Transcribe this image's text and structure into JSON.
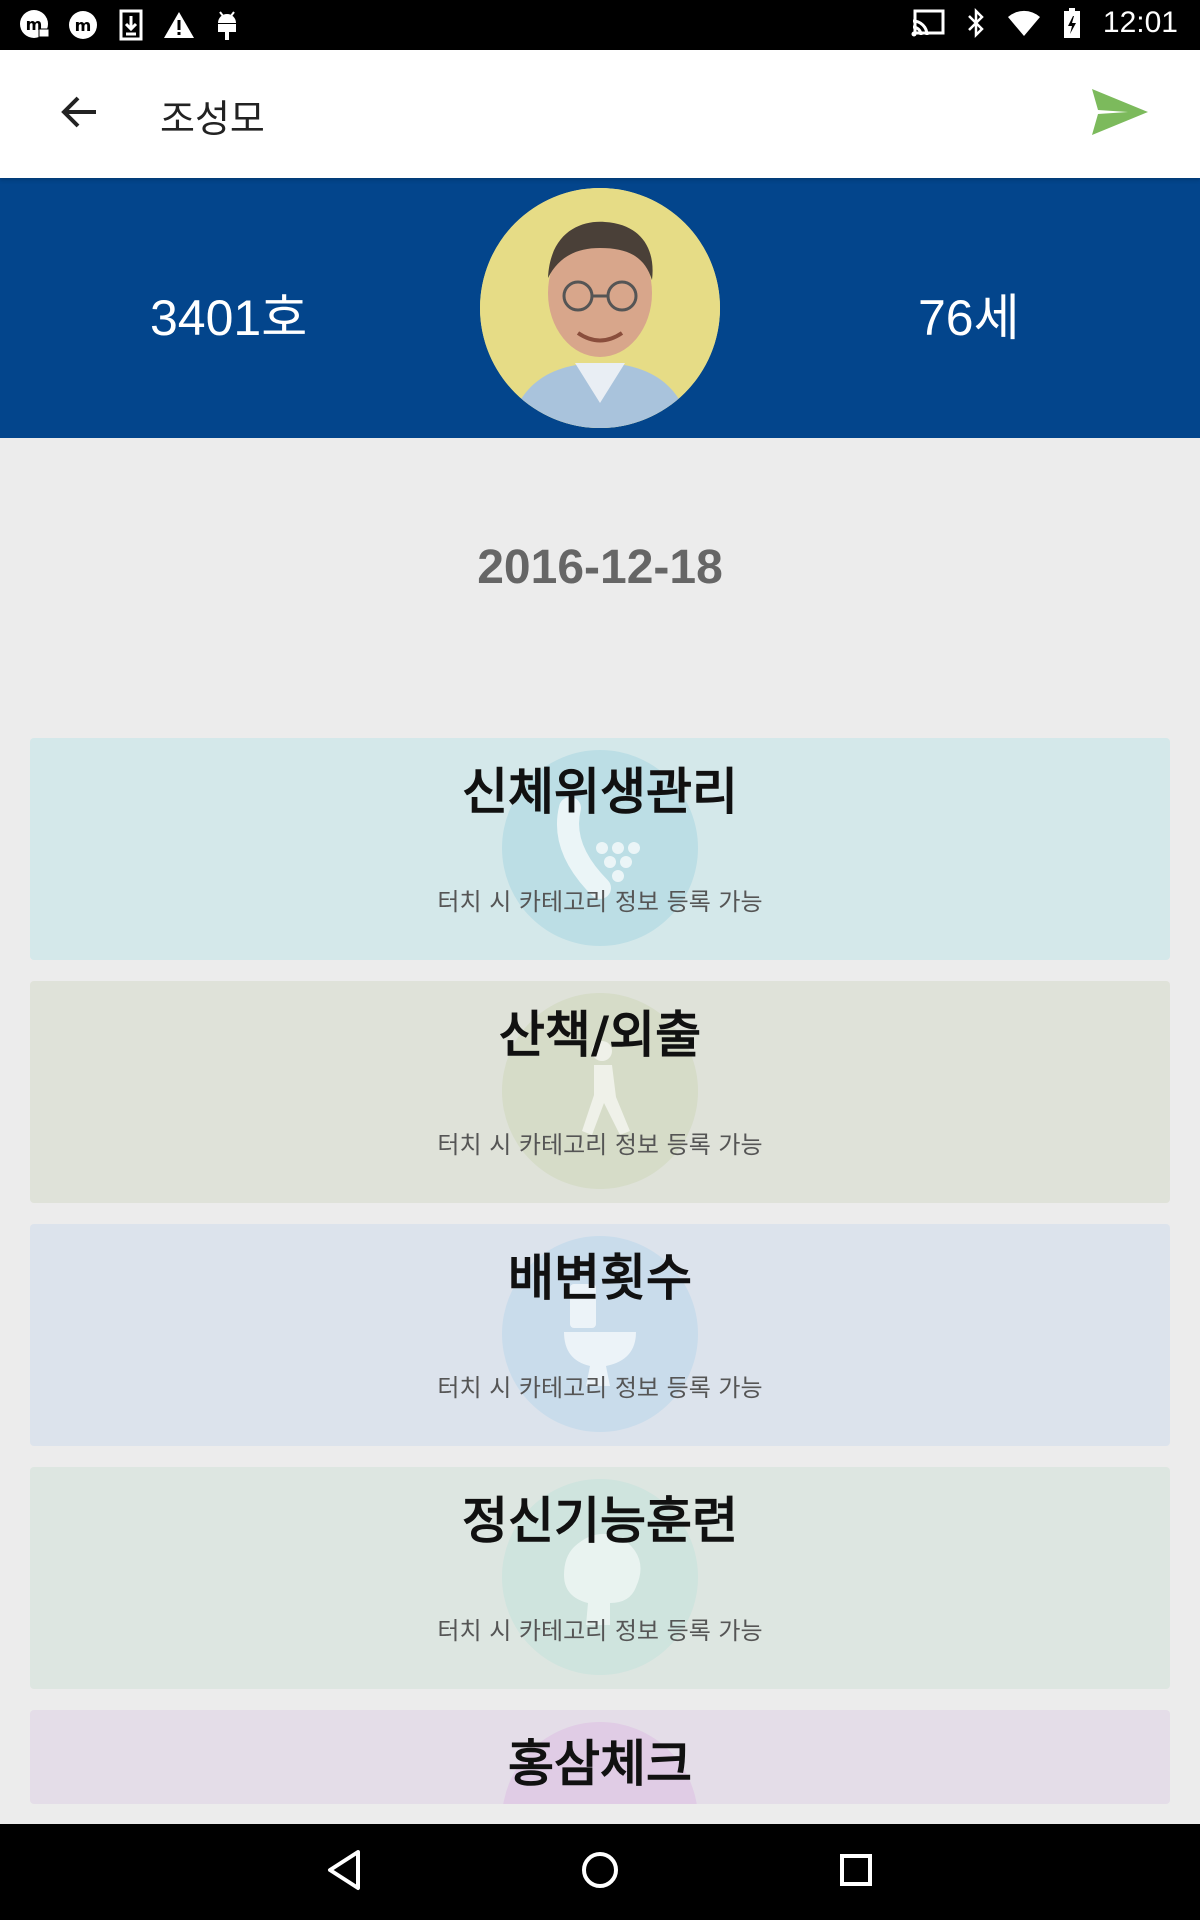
{
  "status_bar": {
    "time": "12:01",
    "left_icons": [
      "m-camera-icon",
      "m-app-icon",
      "download-icon",
      "warning-icon",
      "android-icon"
    ],
    "right_icons": [
      "cast-icon",
      "bluetooth-icon",
      "wifi-icon",
      "battery-icon"
    ]
  },
  "app_bar": {
    "title": "조성모",
    "back_icon": "arrow-back-icon",
    "send_icon": "send-icon",
    "send_color": "#7cba5c"
  },
  "profile": {
    "room": "3401호",
    "age": "76세",
    "header_color": "#03458c"
  },
  "date": "2016-12-18",
  "categories": [
    {
      "title": "신체위생관리",
      "hint": "터치 시 카테고리 정보 등록 가능",
      "icon": "shower-icon",
      "bg": "#d4e8ea"
    },
    {
      "title": "산책/외출",
      "hint": "터치 시 카테고리 정보 등록 가능",
      "icon": "walking-icon",
      "bg": "#dfe2d9"
    },
    {
      "title": "배변횟수",
      "hint": "터치 시 카테고리 정보 등록 가능",
      "icon": "toilet-icon",
      "bg": "#dce3ec"
    },
    {
      "title": "정신기능훈련",
      "hint": "터치 시 카테고리 정보 등록 가능",
      "icon": "brain-icon",
      "bg": "#dde6e1"
    },
    {
      "title": "홍삼체크",
      "hint": "",
      "icon": "ginseng-icon",
      "bg": "#e4dde8"
    }
  ],
  "nav_bar": {
    "icons": [
      "nav-back-icon",
      "nav-home-icon",
      "nav-recents-icon"
    ]
  }
}
